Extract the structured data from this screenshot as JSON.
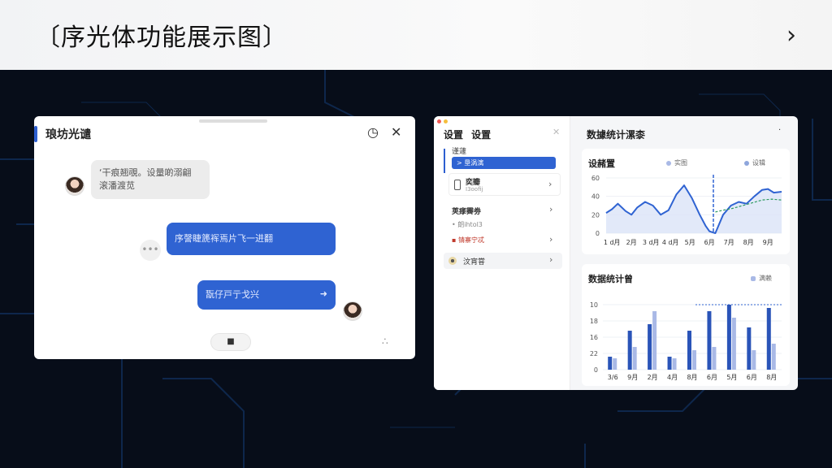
{
  "header": {
    "title": "〔序光体功能展示图〕",
    "next_icon": "›"
  },
  "chat": {
    "title": "琅坊光谴",
    "messages": [
      {
        "from": "other",
        "text_line1": "‘干痕翘覗。设量啲溺翩",
        "text_line2": "滚潘渡苋"
      },
      {
        "from": "me",
        "text": "序謦睫篪裈焉片飞一进翻"
      },
      {
        "from": "me",
        "text": "翫仔戸亍戈兴"
      }
    ],
    "typing": "•••",
    "stop_icon": "■",
    "more_icon": "∴",
    "send_icon": "➜",
    "timer_icon": "◷",
    "close_icon": "✕"
  },
  "dash": {
    "sidebar_title": "设置 设置",
    "sidebar_close": "✕",
    "section1": "谨蘧",
    "active_item": "> 垦涡漓",
    "card_item_title": "奕瓣",
    "card_item_sub": "I3oofij",
    "item2": "荚痵霽劵",
    "item3_line1": "• 朗ihtol3",
    "item3_line2": "▪ 锖寨宁忒",
    "item4": "汶宵甞",
    "title": "数據统计漯桼",
    "menu": "·",
    "colors": {
      "accent": "#2f63d2",
      "light": "#a9b9e6",
      "green": "#2e9a62"
    }
  },
  "chart_data": [
    {
      "type": "line",
      "title": "设赭置",
      "legend": [
        "实图",
        "设辑"
      ],
      "y_ticks": [
        "0",
        "20",
        "40",
        "60"
      ],
      "categories": [
        "1 d月",
        "2月",
        "3 d月",
        "4 d月",
        "5月",
        "6月",
        "7月",
        "8月",
        "9月"
      ],
      "ylim": [
        0,
        60
      ],
      "series": [
        {
          "name": "实图",
          "x": [
            0,
            0.3,
            0.6,
            1,
            1.3,
            1.6,
            2,
            2.4,
            2.8,
            3.2,
            3.6,
            4,
            4.4,
            4.8,
            5.1,
            5.3,
            5.6,
            6,
            6.4,
            6.8,
            7.2,
            7.6,
            8,
            8.3,
            8.6,
            9
          ],
          "values": [
            22,
            26,
            32,
            24,
            20,
            28,
            34,
            30,
            20,
            25,
            42,
            52,
            38,
            20,
            8,
            2,
            0,
            20,
            30,
            34,
            32,
            40,
            47,
            48,
            44,
            45
          ]
        },
        {
          "name": "设辑",
          "x": [
            5.6,
            6,
            6.5,
            7,
            7.5,
            8,
            8.5,
            9
          ],
          "values": [
            23,
            25,
            27,
            30,
            33,
            36,
            37,
            36
          ]
        }
      ],
      "marker_x": 5.5
    },
    {
      "type": "bar",
      "title": "数据统计曾",
      "legend": [
        "满赖"
      ],
      "y_ticks": [
        "0",
        "22",
        "16",
        "18",
        "10"
      ],
      "y_tick_values": [
        0,
        5,
        10,
        15,
        20
      ],
      "categories": [
        "3/6",
        "9月",
        "2月",
        "4月",
        "8月",
        "6月",
        "5月",
        "6月",
        "8月"
      ],
      "ylim": [
        0,
        20
      ],
      "series": [
        {
          "name": "dark",
          "values": [
            4,
            12,
            14,
            4,
            12,
            18,
            20,
            13,
            19
          ]
        },
        {
          "name": "light",
          "values": [
            3.5,
            7,
            18,
            3.5,
            6,
            7,
            16,
            6,
            8
          ]
        }
      ]
    }
  ]
}
